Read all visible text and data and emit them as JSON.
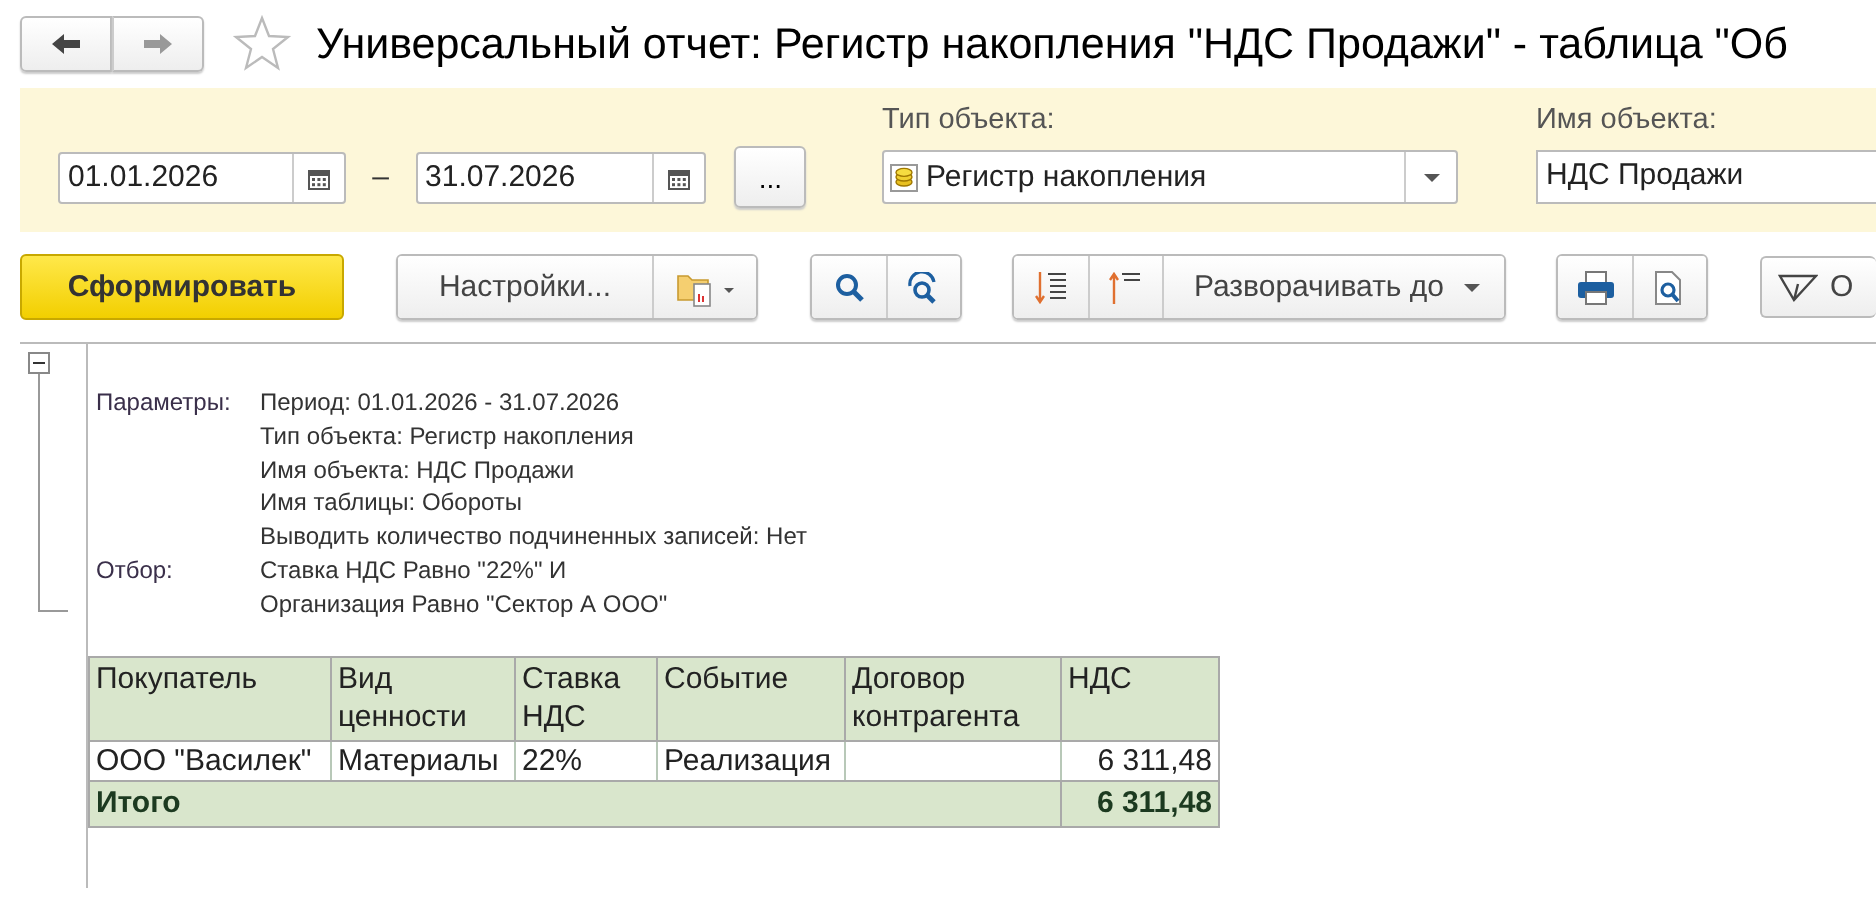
{
  "title": "Универсальный отчет: Регистр накопления \"НДС Продажи\" - таблица \"Об",
  "filters": {
    "date_from": "01.01.2026",
    "date_separator": "–",
    "date_to": "31.07.2026",
    "more_button": "...",
    "object_type": {
      "label": "Тип объекта:",
      "value": "Регистр накопления"
    },
    "object_name": {
      "label": "Имя объекта:",
      "value": "НДС Продажи"
    }
  },
  "toolbar": {
    "generate_button": "Сформировать",
    "settings_button": "Настройки...",
    "expand_button": "Разворачивать до",
    "filter_button": "О"
  },
  "report": {
    "expanded": true,
    "parameters": [
      {
        "label": "Параметры:",
        "lines": [
          "Период: 01.01.2026 - 31.07.2026",
          "Тип объекта: Регистр накопления",
          "Имя объекта: НДС Продажи",
          "Имя таблицы: Обороты",
          "Выводить количество подчиненных записей: Нет"
        ]
      },
      {
        "label": "Отбор:",
        "lines": [
          "Ставка НДС Равно \"22%\" И",
          "Организация Равно \"Сектор А ООО\""
        ]
      }
    ],
    "table": {
      "columns": [
        "Покупатель",
        "Вид ценности",
        "Ставка НДС",
        "Событие",
        "Договор контрагента",
        "НДС"
      ],
      "rows": [
        {
          "cells": [
            "ООО \"Василек\"",
            "Материалы",
            "22%",
            "Реализация",
            null,
            "6 311,48"
          ]
        }
      ],
      "total": {
        "label": "Итого",
        "value": "6 311,48"
      }
    }
  }
}
